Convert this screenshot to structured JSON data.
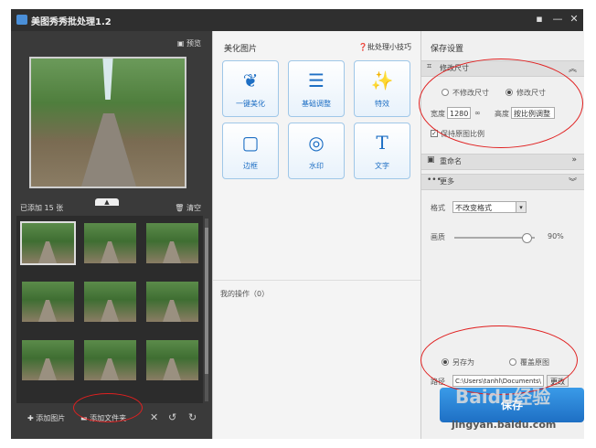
{
  "window": {
    "title": "美图秀秀批处理1.2",
    "menu_icon": "menu-icon",
    "minimize": "—",
    "close": "✕"
  },
  "left": {
    "preview_label": "预览",
    "added_text": "已添加 15 张",
    "clear_label": "清空",
    "add_image_label": "添加图片",
    "add_folder_label": "添加文件夹"
  },
  "center": {
    "section_title": "美化图片",
    "tips_label": "批处理小技巧",
    "tiles": [
      {
        "label": "一键美化",
        "icon": "tulip-icon"
      },
      {
        "label": "基础调整",
        "icon": "sliders-icon"
      },
      {
        "label": "特效",
        "icon": "magic-wand-icon"
      },
      {
        "label": "边框",
        "icon": "frame-icon"
      },
      {
        "label": "水印",
        "icon": "watermark-icon"
      },
      {
        "label": "文字",
        "icon": "text-icon"
      }
    ],
    "ops_label": "我的操作（0）"
  },
  "right": {
    "title": "保存设置",
    "resize_bar": "修改尺寸",
    "no_resize": "不修改尺寸",
    "do_resize": "修改尺寸",
    "width_label": "宽度",
    "width_value": "1280",
    "height_label": "高度",
    "height_value": "按比例调整",
    "keep_ratio": "保持原图比例",
    "rename_bar": "重命名",
    "more_bar": "更多",
    "format_label": "格式",
    "format_value": "不改变格式",
    "quality_label": "画质",
    "quality_value": "90%",
    "quality_level": 0.9,
    "save_as": "另存为",
    "overwrite": "覆盖原图",
    "path_label": "路径",
    "path_value": "C:\\Users\\tanhl\\Documents\\",
    "browse": "更改",
    "save_button": "保存"
  },
  "watermark": {
    "brand": "Baidu经验",
    "url": "jingyan.baidu.com"
  }
}
